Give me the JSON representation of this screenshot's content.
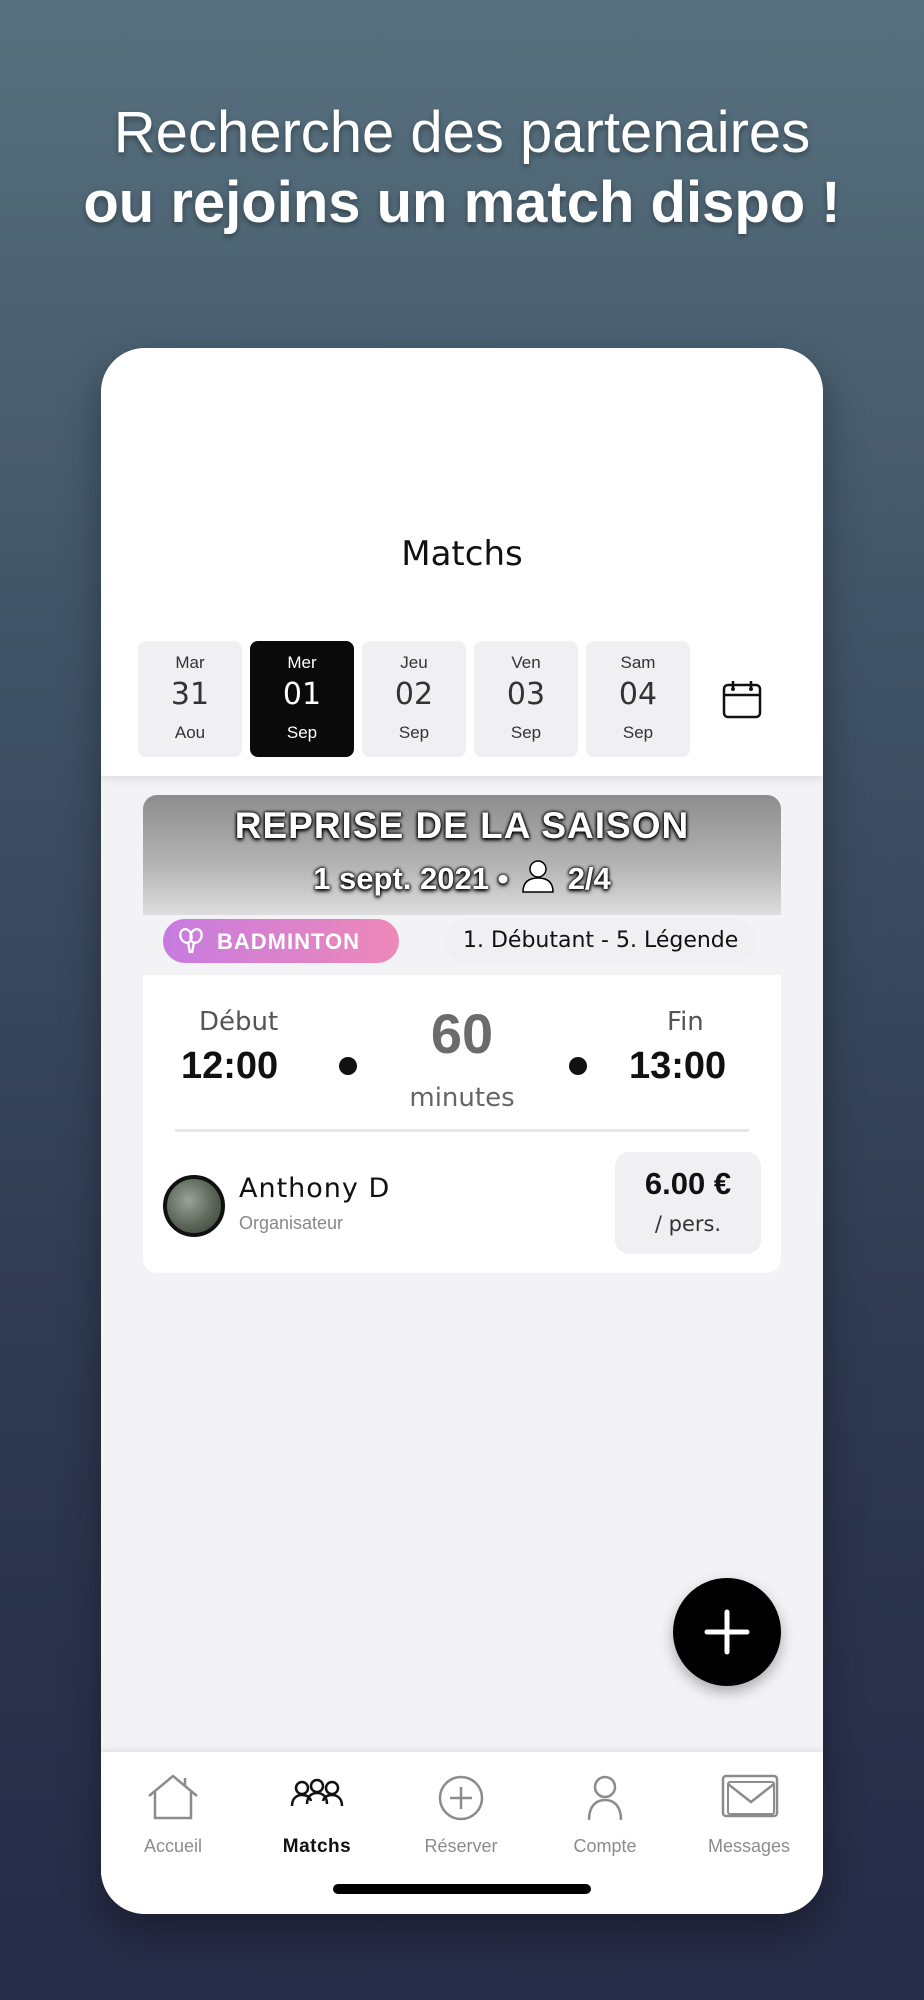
{
  "headline": {
    "line1": "Recherche des partenaires",
    "line2": "ou rejoins un match dispo !"
  },
  "app": {
    "title": "Matchs"
  },
  "dates": [
    {
      "dow": "Mar",
      "num": "31",
      "month": "Aou",
      "selected": false
    },
    {
      "dow": "Mer",
      "num": "01",
      "month": "Sep",
      "selected": true
    },
    {
      "dow": "Jeu",
      "num": "02",
      "month": "Sep",
      "selected": false
    },
    {
      "dow": "Ven",
      "num": "03",
      "month": "Sep",
      "selected": false
    },
    {
      "dow": "Sam",
      "num": "04",
      "month": "Sep",
      "selected": false
    }
  ],
  "calendar_icon": "calendar-icon",
  "match": {
    "title": "REPRISE DE LA SAISON",
    "date": "1 sept. 2021 •",
    "players": "2/4",
    "sport": "BADMINTON",
    "sport_icon": "badminton-racket-icon",
    "level": "1. Débutant - 5. Légende",
    "start_label": "Début",
    "start_time": "12:00",
    "duration": "60",
    "duration_unit": "minutes",
    "end_label": "Fin",
    "end_time": "13:00",
    "organizer_name": "Anthony D",
    "organizer_role": "Organisateur",
    "price": "6.00 €",
    "price_unit": "/ pers."
  },
  "fab_icon": "plus-icon",
  "tabs": [
    {
      "label": "Accueil",
      "icon": "home-icon",
      "active": false
    },
    {
      "label": "Matchs",
      "icon": "group-icon",
      "active": true
    },
    {
      "label": "Réserver",
      "icon": "plus-circle-icon",
      "active": false
    },
    {
      "label": "Compte",
      "icon": "user-icon",
      "active": false
    },
    {
      "label": "Messages",
      "icon": "mail-icon",
      "active": false
    }
  ],
  "colors": {
    "selected_day": "#0a0a0a",
    "badge_gradient_start": "#c77be0",
    "badge_gradient_end": "#ee88b8",
    "fab": "#000000"
  }
}
